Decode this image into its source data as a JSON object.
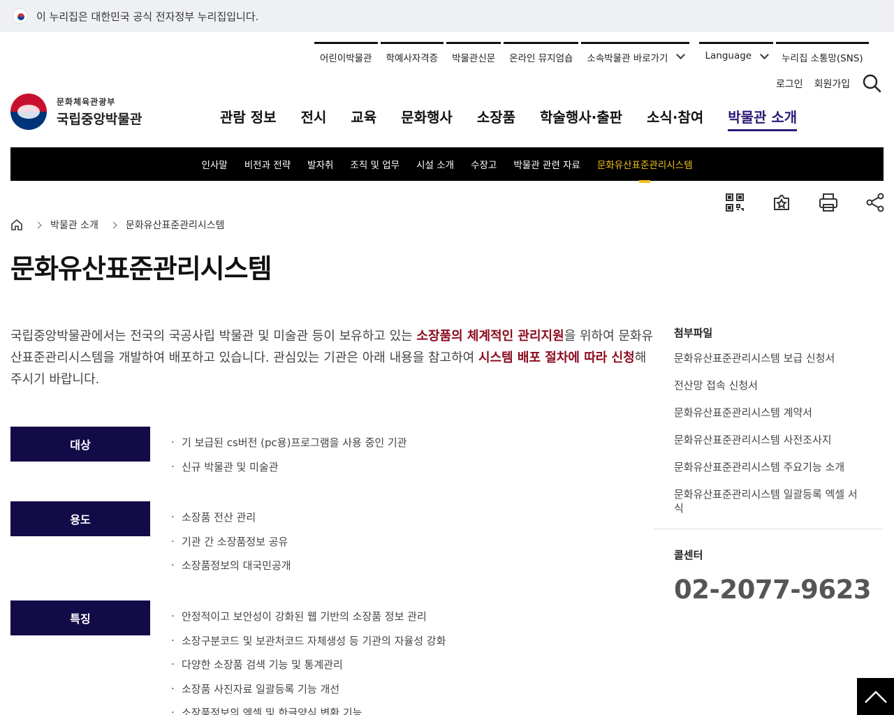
{
  "gov_banner": {
    "text": "이 누리집은 대한민국 공식 전자정부 누리집입니다."
  },
  "util_top": {
    "items": [
      "어린이박물관",
      "학예사자격증",
      "박물관신문",
      "온라인 뮤지엄숍",
      "소속박물관 바로가기"
    ],
    "language": "Language",
    "sns": "누리집 소통망(SNS)"
  },
  "util_login": {
    "login": "로그인",
    "join": "회원가입"
  },
  "logo": {
    "line1": "문화체육관광부",
    "line2": "국립중앙박물관"
  },
  "gnb": [
    "관람 정보",
    "전시",
    "교육",
    "문화행사",
    "소장품",
    "학술행사·출판",
    "소식·참여",
    "박물관 소개"
  ],
  "subnav": [
    "인사말",
    "비전과 전략",
    "발자취",
    "조직 및 업무",
    "시설 소개",
    "수장고",
    "박물관 관련 자료",
    "문화유산표준관리시스템"
  ],
  "breadcrumb": {
    "level1": "박물관 소개",
    "level2": "문화유산표준관리시스템"
  },
  "page_title": "문화유산표준관리시스템",
  "intro": {
    "p1": "국립중앙박물관에서는 전국의 국공사립 박물관 및 미술관 등이 보유하고 있는 ",
    "h1": "소장품의 체계적인 관리지원",
    "p2": "을 위하여 문화유산표준관리시스템을 개발하여 배포하고 있습니다. 관심있는 기관은 아래 내용을 참고하여 ",
    "h2": "시스템 배포 절차에 따라 신청",
    "p3": "해주시기 바랍니다."
  },
  "sections": [
    {
      "label": "대상",
      "items": [
        "기 보급된 cs버전 (pc용)프로그램을 사용 중인 기관",
        "신규 박물관 및 미술관"
      ]
    },
    {
      "label": "용도",
      "items": [
        "소장품 전산 관리",
        "기관 간 소장품정보 공유",
        "소장품정보의 대국민공개"
      ]
    },
    {
      "label": "특징",
      "items": [
        "안정적이고 보안성이 강화된 웹 기반의 소장품 정보 관리",
        "소장구분코드 및 보관처코드 자체생성 등 기관의 자율성 강화",
        "다양한 소장품 검색 기능 및 통계관리",
        "소장품 사진자료 일괄등록 기능 개선",
        "소장품정보의 엑셀 및 한글양식 변환 기능"
      ]
    }
  ],
  "aside": {
    "files_title": "첨부파일",
    "files": [
      "문화유산표준관리시스템 보급 신청서",
      "전산망 접속 신청서",
      "문화유산표준관리시스템 계약서",
      "문화유산표준관리시스템 사전조사지",
      "문화유산표준관리시스템 주요기능 소개",
      "문화유산표준관리시스템 일괄등록 엑셀 서식"
    ],
    "call_title": "콜센터",
    "call_number": "02-2077-9623"
  },
  "colors": {
    "primary": "#2c1a77",
    "label_bg": "#120b47",
    "highlight": "#8b0a1e",
    "subnav_active": "#f2c21b"
  },
  "icons": [
    "qr-code-icon",
    "bookmark-star-icon",
    "print-icon",
    "share-icon",
    "home-icon",
    "search-icon",
    "arrow-up-icon"
  ]
}
